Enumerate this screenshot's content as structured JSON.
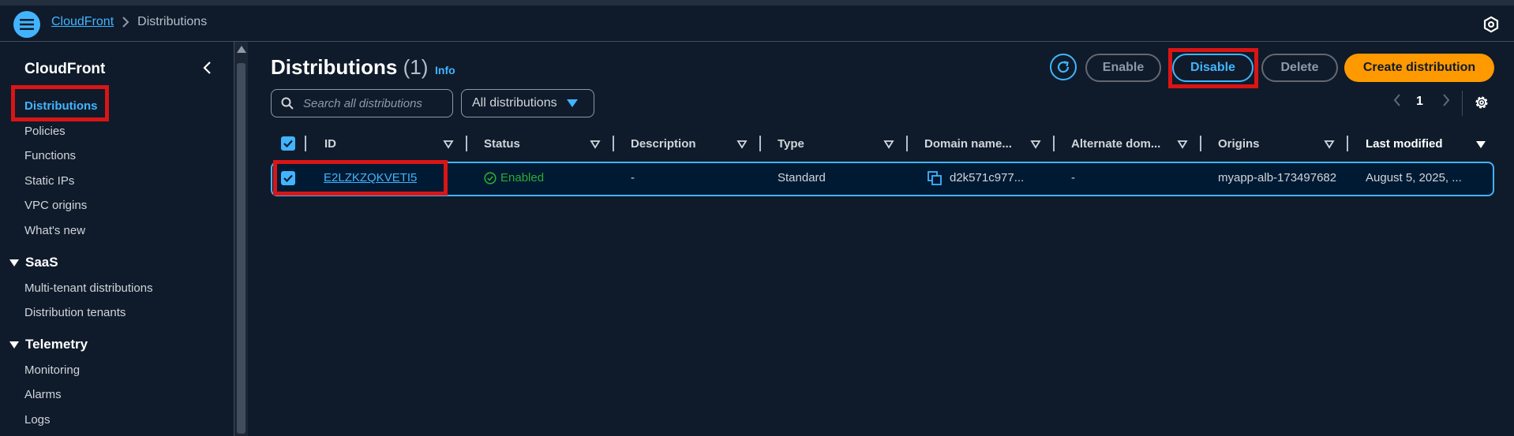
{
  "header": {
    "breadcrumb": {
      "service": "CloudFront",
      "current": "Distributions"
    },
    "icons": {
      "menu": "hamburger-icon",
      "settings": "gear-icon",
      "separator": "chevron-right-icon"
    }
  },
  "sidebar": {
    "title": "CloudFront",
    "items": [
      "Distributions",
      "Policies",
      "Functions",
      "Static IPs",
      "VPC origins",
      "What's new"
    ],
    "sections": [
      {
        "title": "SaaS",
        "items": [
          "Multi-tenant distributions",
          "Distribution tenants"
        ]
      },
      {
        "title": "Telemetry",
        "items": [
          "Monitoring",
          "Alarms",
          "Logs"
        ]
      }
    ],
    "active": "Distributions"
  },
  "main": {
    "title": "Distributions",
    "count": "(1)",
    "info": "Info",
    "buttons": {
      "enable": "Enable",
      "disable": "Disable",
      "delete": "Delete",
      "create": "Create distribution"
    },
    "search": {
      "placeholder": "Search all distributions"
    },
    "filter": {
      "selected": "All distributions"
    },
    "pagination": {
      "current_page": "1"
    },
    "table": {
      "columns": [
        "ID",
        "Status",
        "Description",
        "Type",
        "Domain name...",
        "Alternate dom...",
        "Origins",
        "Last modified"
      ],
      "rows": [
        {
          "id": "E2LZKZQKVETI5",
          "status": "Enabled",
          "description": "-",
          "type": "Standard",
          "domain": "d2k571c977...",
          "alternate": "-",
          "origins": "myapp-alb-173497682",
          "last_modified": "August 5, 2025, ..."
        }
      ]
    }
  },
  "colors": {
    "accent": "#42b4ff",
    "primary": "#ff9900",
    "success": "#29ad32",
    "highlight": "#d91515",
    "background": "#0f1b2a"
  }
}
